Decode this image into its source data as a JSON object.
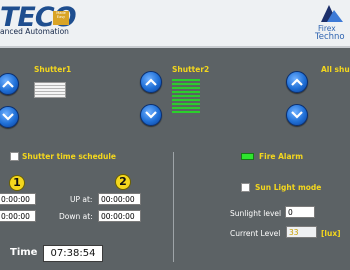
{
  "header": {
    "brand": "TECO",
    "badge_line1": "Made",
    "badge_line2": "Easy",
    "slogan": "anced Automation",
    "partner_line1": "Firex",
    "partner_line2": "Techno"
  },
  "shutters": {
    "shutter1_label": "Shutter1",
    "shutter2_label": "Shutter2",
    "all_label": "All shu"
  },
  "schedule": {
    "checkbox_label": "Shutter time schedule",
    "badge_1": "1",
    "badge_2": "2",
    "up_at_label": "UP at:",
    "down_at_label": "Down at:",
    "left_up_value": "0:00:00",
    "left_down_value": "0:00:00",
    "up_at_value": "00:00:00",
    "down_at_value": "00:00:00"
  },
  "status": {
    "fire_alarm_label": "Fire Alarm",
    "sun_light_label": "Sun Light mode",
    "sunlight_level_label": "Sunlight level",
    "sunlight_level_value": "0",
    "current_level_label": "Current Level",
    "current_level_value": "33",
    "unit": "[lux]"
  },
  "clock": {
    "label": "Time",
    "value": "07:38:54"
  },
  "colors": {
    "background": "#5c6265",
    "accent_yellow": "#f4d71d",
    "button_blue": "#1f6fd6",
    "alarm_green": "#2ee62e"
  }
}
